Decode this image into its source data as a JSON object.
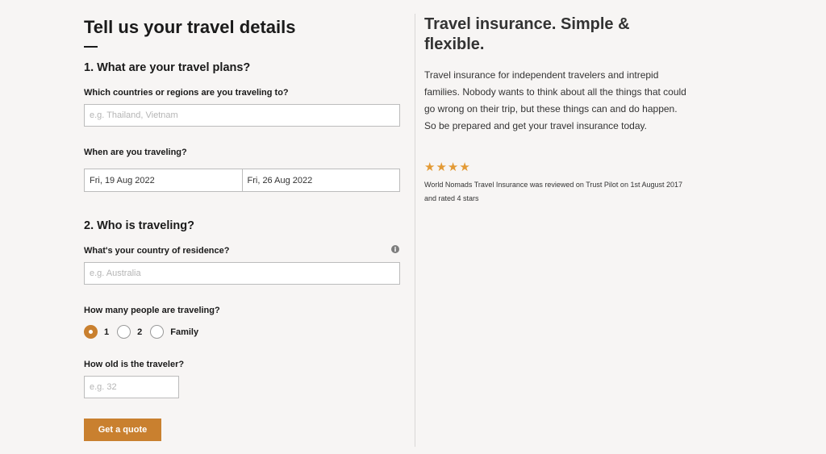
{
  "form": {
    "title": "Tell us your travel details",
    "section1": {
      "heading": "1. What are your travel plans?",
      "destinations_label": "Which countries or regions are you traveling to?",
      "destinations_placeholder": "e.g. Thailand, Vietnam",
      "dates_label": "When are you traveling?",
      "start_date": "Fri, 19 Aug 2022",
      "end_date": "Fri, 26 Aug 2022"
    },
    "section2": {
      "heading": "2. Who is traveling?",
      "residence_label": "What's your country of residence?",
      "residence_placeholder": "e.g. Australia",
      "info_icon": "i",
      "people_label": "How many people are traveling?",
      "people_options": [
        "1",
        "2",
        "Family"
      ],
      "people_selected": "1",
      "age_label": "How old is the traveler?",
      "age_placeholder": "e.g. 32"
    },
    "submit_label": "Get a quote"
  },
  "promo": {
    "title": "Travel insurance. Simple & flexible.",
    "body": "Travel insurance for independent travelers and intrepid families. Nobody wants to think about all the things that could go wrong on their trip, but these things can and do happen. So be prepared and get your travel insurance today.",
    "rating_stars": 4,
    "review_note": "World Nomads Travel Insurance was reviewed on Trust Pilot on 1st August 2017 and rated 4 stars"
  },
  "colors": {
    "accent": "#c9802f",
    "star": "#e39a35",
    "background": "#f7f5f4"
  }
}
